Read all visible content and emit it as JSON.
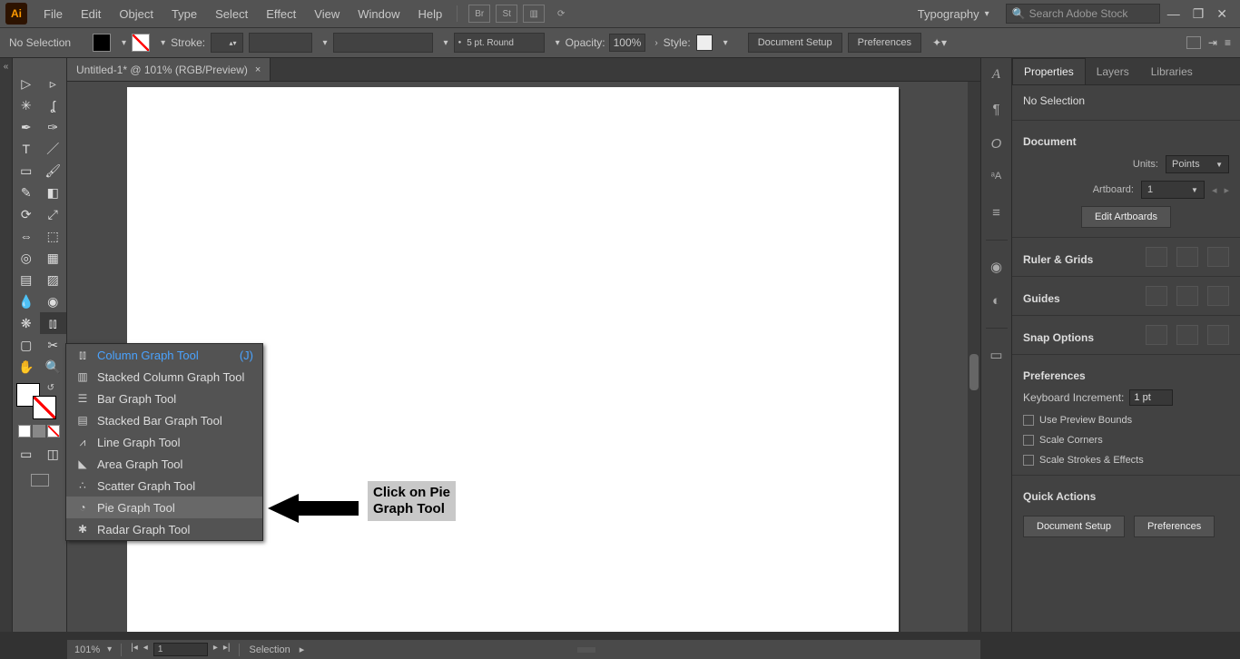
{
  "app": {
    "logo": "Ai"
  },
  "menu": [
    "File",
    "Edit",
    "Object",
    "Type",
    "Select",
    "Effect",
    "View",
    "Window",
    "Help"
  ],
  "bridge_icons": [
    "Br",
    "St"
  ],
  "workspace": "Typography",
  "search_placeholder": "Search Adobe Stock",
  "options": {
    "selection": "No Selection",
    "stroke_label": "Stroke:",
    "brush": "5 pt. Round",
    "opacity_label": "Opacity:",
    "opacity_value": "100%",
    "style_label": "Style:",
    "doc_setup": "Document Setup",
    "prefs": "Preferences"
  },
  "document_tab": "Untitled-1* @ 101% (RGB/Preview)",
  "graph_tools": [
    {
      "label": "Column Graph Tool",
      "shortcut": "(J)"
    },
    {
      "label": "Stacked Column Graph Tool"
    },
    {
      "label": "Bar Graph Tool"
    },
    {
      "label": "Stacked Bar Graph Tool"
    },
    {
      "label": "Line Graph Tool"
    },
    {
      "label": "Area Graph Tool"
    },
    {
      "label": "Scatter Graph Tool"
    },
    {
      "label": "Pie Graph Tool"
    },
    {
      "label": "Radar Graph Tool"
    }
  ],
  "annotation": {
    "line1": "Click on Pie",
    "line2": "Graph Tool"
  },
  "panel": {
    "tabs": [
      "Properties",
      "Layers",
      "Libraries"
    ],
    "no_selection": "No Selection",
    "document": "Document",
    "units_label": "Units:",
    "units_value": "Points",
    "artboard_label": "Artboard:",
    "artboard_value": "1",
    "edit_artboards": "Edit Artboards",
    "ruler_grids": "Ruler & Grids",
    "guides": "Guides",
    "snap_options": "Snap Options",
    "preferences": "Preferences",
    "kbd_label": "Keyboard Increment:",
    "kbd_value": "1 pt",
    "cb1": "Use Preview Bounds",
    "cb2": "Scale Corners",
    "cb3": "Scale Strokes & Effects",
    "quick_actions": "Quick Actions",
    "qa1": "Document Setup",
    "qa2": "Preferences"
  },
  "status": {
    "zoom": "101%",
    "artboard_num": "1",
    "mode": "Selection"
  }
}
